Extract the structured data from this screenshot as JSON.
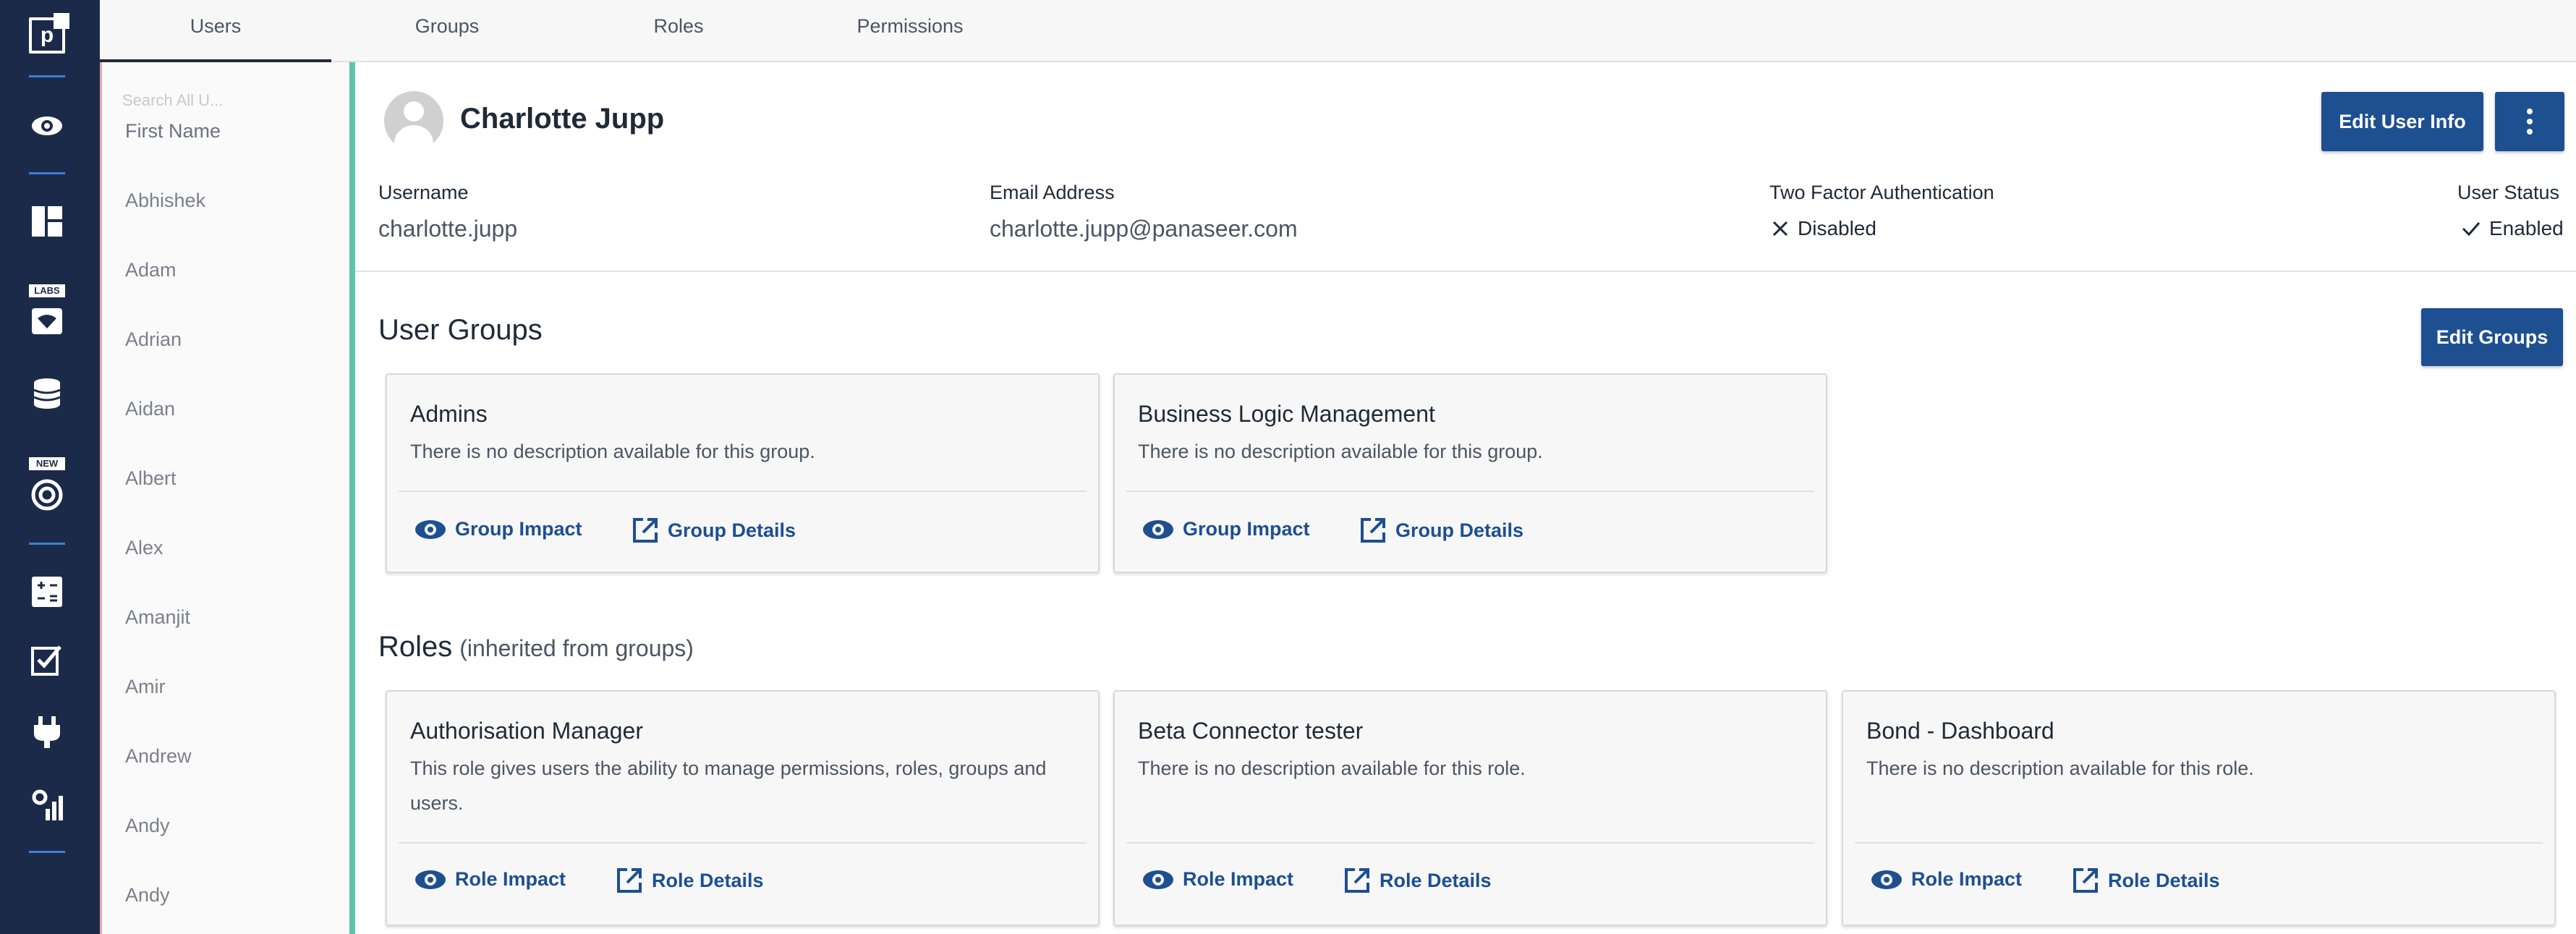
{
  "nav_rail": {
    "logo": "p",
    "labs_badge": "LABS",
    "new_badge": "NEW",
    "icons": [
      "eye-icon",
      "dashboard-icon",
      "labs-icon",
      "database-icon",
      "target-icon",
      "calculator-icon",
      "checklist-icon",
      "plug-icon",
      "settings-chart-icon"
    ]
  },
  "tabs": [
    {
      "label": "Users",
      "active": true
    },
    {
      "label": "Groups",
      "active": false
    },
    {
      "label": "Roles",
      "active": false
    },
    {
      "label": "Permissions",
      "active": false
    }
  ],
  "user_list": {
    "search_placeholder_fragment": "Search All U...",
    "column_header": "First Name",
    "names": [
      "Abhishek",
      "Adam",
      "Adrian",
      "Aidan",
      "Albert",
      "Alex",
      "Amanjit",
      "Amir",
      "Andrew",
      "Andy",
      "Andy"
    ]
  },
  "user": {
    "name": "Charlotte Jupp",
    "edit_info_label": "Edit User Info",
    "username_label": "Username",
    "username": "charlotte.jupp",
    "email_label": "Email Address",
    "email": "charlotte.jupp@panaseer.com",
    "tfa_label": "Two Factor Authentication",
    "tfa_status": "Disabled",
    "status_label": "User Status",
    "status": "Enabled"
  },
  "groups_section": {
    "title": "User Groups",
    "edit_label": "Edit Groups",
    "cards": [
      {
        "title": "Admins",
        "description": "There is no description available for this group.",
        "impact": "Group Impact",
        "details": "Group Details"
      },
      {
        "title": "Business Logic Management",
        "description": "There is no description available for this group.",
        "impact": "Group Impact",
        "details": "Group Details"
      }
    ]
  },
  "roles_section": {
    "title": "Roles",
    "subtitle": "(inherited from groups)",
    "cards": [
      {
        "title": "Authorisation Manager",
        "description": "This role gives users the ability to manage permissions, roles, groups and users.",
        "impact": "Role Impact",
        "details": "Role Details"
      },
      {
        "title": "Beta Connector tester",
        "description": "There is no description available for this role.",
        "impact": "Role Impact",
        "details": "Role Details"
      },
      {
        "title": "Bond - Dashboard",
        "description": "There is no description available for this role.",
        "impact": "Role Impact",
        "details": "Role Details"
      }
    ]
  },
  "colors": {
    "rail": "#1c2a4a",
    "accent": "#1d4f91",
    "splitter": "#5cc6ae"
  }
}
